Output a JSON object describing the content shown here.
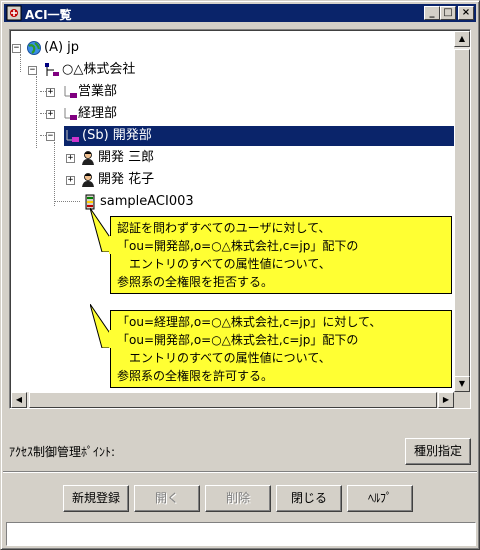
{
  "window": {
    "title": "ACI一覧",
    "minimize_glyph": "_",
    "maximize_glyph": "□",
    "close_glyph": "×"
  },
  "tree": {
    "nodes": [
      {
        "label": "(A) jp",
        "icon": "globe-icon",
        "expanded": true
      },
      {
        "label": "○△株式会社",
        "icon": "organization-icon",
        "expanded": true
      },
      {
        "label": "営業部",
        "icon": "org-unit-icon",
        "expanded": false
      },
      {
        "label": "経理部",
        "icon": "org-unit-icon",
        "expanded": false
      },
      {
        "label": "(Sb) 開発部",
        "icon": "org-unit-icon",
        "expanded": true,
        "selected": true
      },
      {
        "label": "開発 三郎",
        "icon": "person-icon",
        "expanded": false
      },
      {
        "label": "開発 花子",
        "icon": "person-icon",
        "expanded": false
      },
      {
        "label": "sampleACI003",
        "icon": "aci-icon"
      }
    ],
    "notes": [
      {
        "lines": [
          "認証を問わずすべてのユーザに対して、",
          "「ou=開発部,o=○△株式会社,c=jp」配下の",
          "　エントリのすべての属性値について、",
          "参照系の全権限を拒否する。"
        ]
      },
      {
        "lines": [
          "「ou=経理部,o=○△株式会社,c=jp」に対して、",
          "「ou=開発部,o=○△株式会社,c=jp」配下の",
          "　エントリのすべての属性値について、",
          "参照系の全権限を許可する。"
        ]
      }
    ],
    "selected_color": "#0a246a",
    "note_color": "#ffff33"
  },
  "management": {
    "label": "ｱｸｾｽ制御管理ﾎﾟｲﾝﾄ:",
    "type_button": "種別指定"
  },
  "buttons": {
    "new": "新規登録",
    "open": "開く",
    "delete": "削除",
    "close": "閉じる",
    "help": "ﾍﾙﾌﾟ"
  },
  "status": {
    "text": ""
  }
}
